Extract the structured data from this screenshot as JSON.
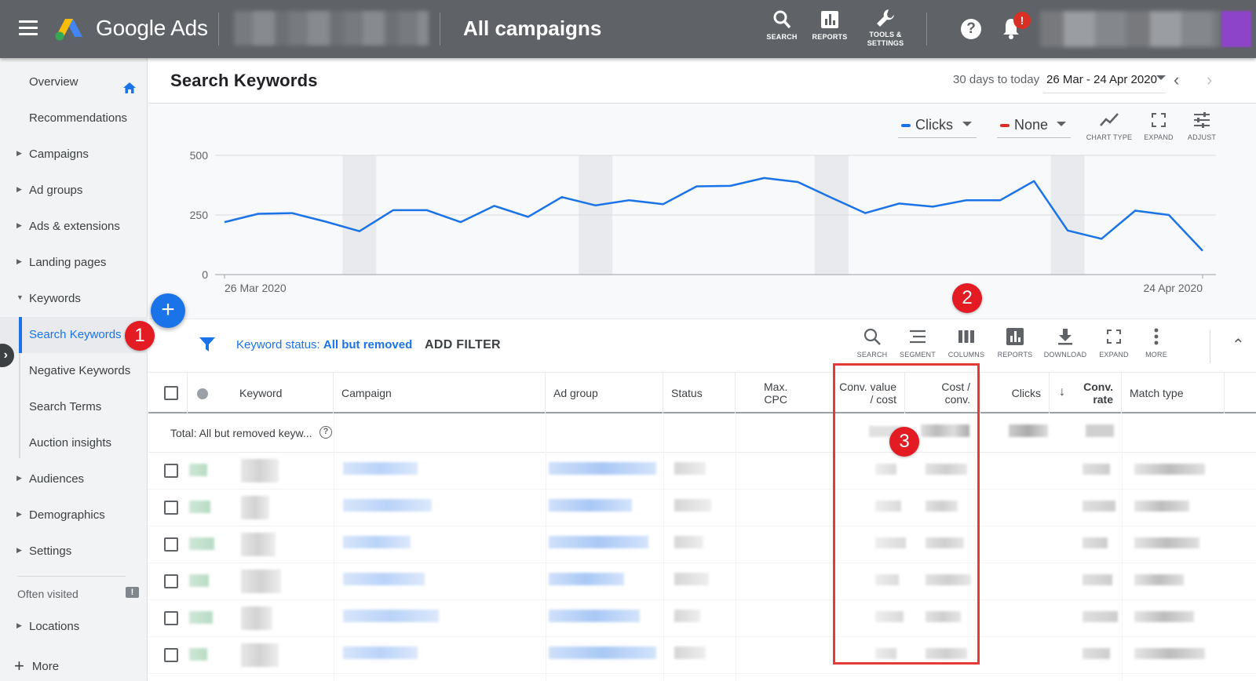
{
  "app": {
    "brand": "Google Ads",
    "context_title": "All campaigns"
  },
  "topbar": {
    "tools": [
      {
        "label": "SEARCH",
        "icon": "search-icon"
      },
      {
        "label": "REPORTS",
        "icon": "reports-icon"
      },
      {
        "label_1": "TOOLS &",
        "label_2": "SETTINGS",
        "icon": "wrench-icon"
      }
    ],
    "help": "?",
    "notification_badge": "!"
  },
  "sidebar": {
    "items": [
      {
        "label": "Overview"
      },
      {
        "label": "Recommendations"
      },
      {
        "label": "Campaigns"
      },
      {
        "label": "Ad groups"
      },
      {
        "label": "Ads & extensions"
      },
      {
        "label": "Landing pages"
      },
      {
        "label": "Keywords"
      },
      {
        "label": "Search Keywords"
      },
      {
        "label": "Negative Keywords"
      },
      {
        "label": "Search Terms"
      },
      {
        "label": "Auction insights"
      },
      {
        "label": "Audiences"
      },
      {
        "label": "Demographics"
      },
      {
        "label": "Settings"
      }
    ],
    "often_visited": "Often visited",
    "locations": "Locations",
    "more": "More"
  },
  "header": {
    "title": "Search Keywords",
    "range_label": "30 days to today",
    "range_value": "26 Mar - 24 Apr 2020"
  },
  "chart_controls": {
    "metric1": "Clicks",
    "metric1_color": "#1a73e8",
    "metric2": "None",
    "metric2_color": "#d93025",
    "tools": [
      "CHART TYPE",
      "EXPAND",
      "ADJUST"
    ]
  },
  "chart_data": {
    "type": "line",
    "x_start": "26 Mar 2020",
    "x_end": "24 Apr 2020",
    "yticks": [
      "500",
      "250",
      "0"
    ],
    "ylim": [
      0,
      500
    ],
    "series": [
      {
        "color": "#1a73e8",
        "values": [
          220,
          255,
          258,
          222,
          182,
          270,
          270,
          220,
          288,
          242,
          325,
          290,
          312,
          295,
          370,
          372,
          405,
          388,
          322,
          258,
          298,
          285,
          312,
          312,
          392,
          185,
          150,
          268,
          250,
          100
        ]
      }
    ],
    "weekend_bands": [
      4,
      11,
      18,
      25
    ],
    "grid": true
  },
  "table_toolbar": {
    "filter_prefix": "Keyword status: ",
    "filter_value": "All but removed",
    "add_filter": "ADD FILTER",
    "tools": [
      "SEARCH",
      "SEGMENT",
      "COLUMNS",
      "REPORTS",
      "DOWNLOAD",
      "EXPAND",
      "MORE"
    ]
  },
  "table": {
    "columns": {
      "keyword": "Keyword",
      "campaign": "Campaign",
      "ad_group": "Ad group",
      "status": "Status",
      "max_cpc_1": "Max.",
      "max_cpc_2": "CPC",
      "conv_value_1": "Conv. value",
      "conv_value_2": "/ cost",
      "cost_conv_1": "Cost /",
      "cost_conv_2": "conv.",
      "clicks": "Clicks",
      "conv_rate_1": "Conv.",
      "conv_rate_2": "rate",
      "match_type": "Match type"
    },
    "total_label": "Total: All but removed keyw..."
  },
  "annotations": {
    "m1": "1",
    "m2": "2",
    "m3": "3",
    "fab": "+"
  }
}
